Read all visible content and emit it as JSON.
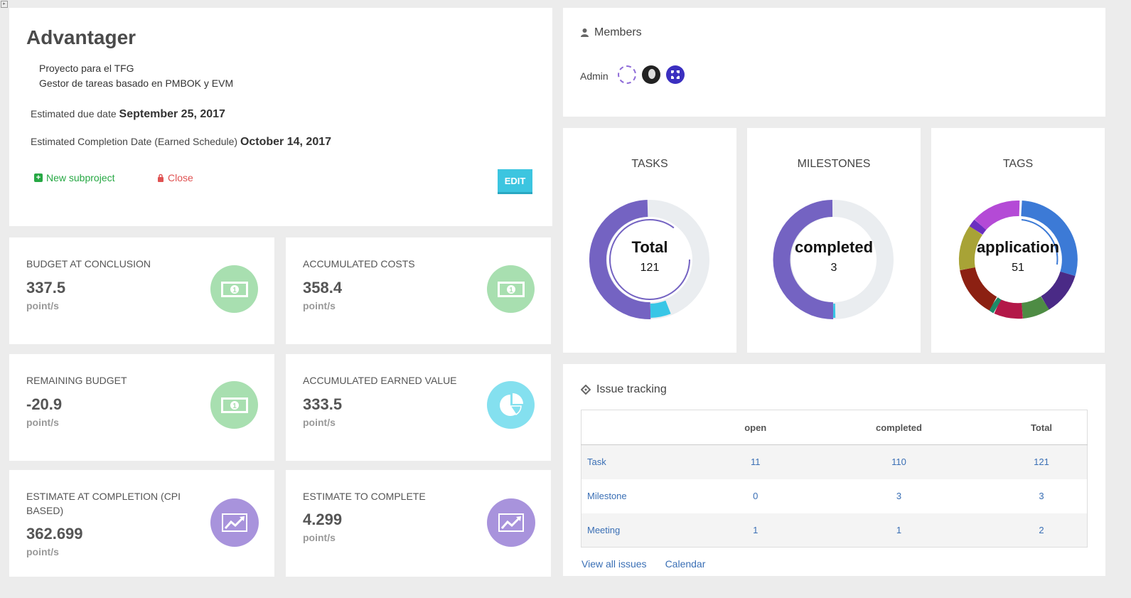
{
  "project": {
    "title": "Advantager",
    "description_line1": "Proyecto para el TFG",
    "description_line2": "Gestor de tareas basado en PMBOK y EVM",
    "due_label": "Estimated due date",
    "due_value": "September 25, 2017",
    "completion_label": "Estimated Completion Date (Earned Schedule)",
    "completion_value": "October 14, 2017",
    "new_subproject_label": "New subproject",
    "close_label": "Close",
    "edit_label": "EDIT"
  },
  "stats": [
    {
      "label": "BUDGET AT CONCLUSION",
      "value": "337.5",
      "unit": "point/s",
      "icon": "money-icon",
      "color": "#a8dfb0"
    },
    {
      "label": "ACCUMULATED COSTS",
      "value": "358.4",
      "unit": "point/s",
      "icon": "money-icon",
      "color": "#a8dfb0"
    },
    {
      "label": "REMAINING BUDGET",
      "value": "-20.9",
      "unit": "point/s",
      "icon": "money-icon",
      "color": "#a8dfb0"
    },
    {
      "label": "ACCUMULATED EARNED VALUE",
      "value": "333.5",
      "unit": "point/s",
      "icon": "pie-chart-icon",
      "color": "#84e0ef"
    },
    {
      "label": "ESTIMATE AT COMPLETION (CPI BASED)",
      "value": "362.699",
      "unit": "point/s",
      "icon": "trend-up-icon",
      "color": "#a893dc"
    },
    {
      "label": "ESTIMATE TO COMPLETE",
      "value": "4.299",
      "unit": "point/s",
      "icon": "trend-up-icon",
      "color": "#a893dc"
    }
  ],
  "members": {
    "title": "Members",
    "admin_label": "Admin"
  },
  "donuts": {
    "tasks": {
      "title": "TASKS",
      "center_label": "Total",
      "center_value": "121"
    },
    "milestones": {
      "title": "MILESTONES",
      "center_label": "completed",
      "center_value": "3"
    },
    "tags": {
      "title": "TAGS",
      "center_label": "application",
      "center_value": "51"
    }
  },
  "issues": {
    "title": "Issue tracking",
    "columns": [
      "",
      "open",
      "completed",
      "Total"
    ],
    "rows": [
      {
        "name": "Task",
        "open": "11",
        "completed": "110",
        "total": "121"
      },
      {
        "name": "Milestone",
        "open": "0",
        "completed": "3",
        "total": "3"
      },
      {
        "name": "Meeting",
        "open": "1",
        "completed": "1",
        "total": "2"
      }
    ],
    "view_all_label": "View all issues",
    "calendar_label": "Calendar"
  },
  "colors": {
    "accent": "#3cc5e0",
    "success": "#27a844",
    "danger": "#e05252",
    "link": "#3a6fb5"
  }
}
